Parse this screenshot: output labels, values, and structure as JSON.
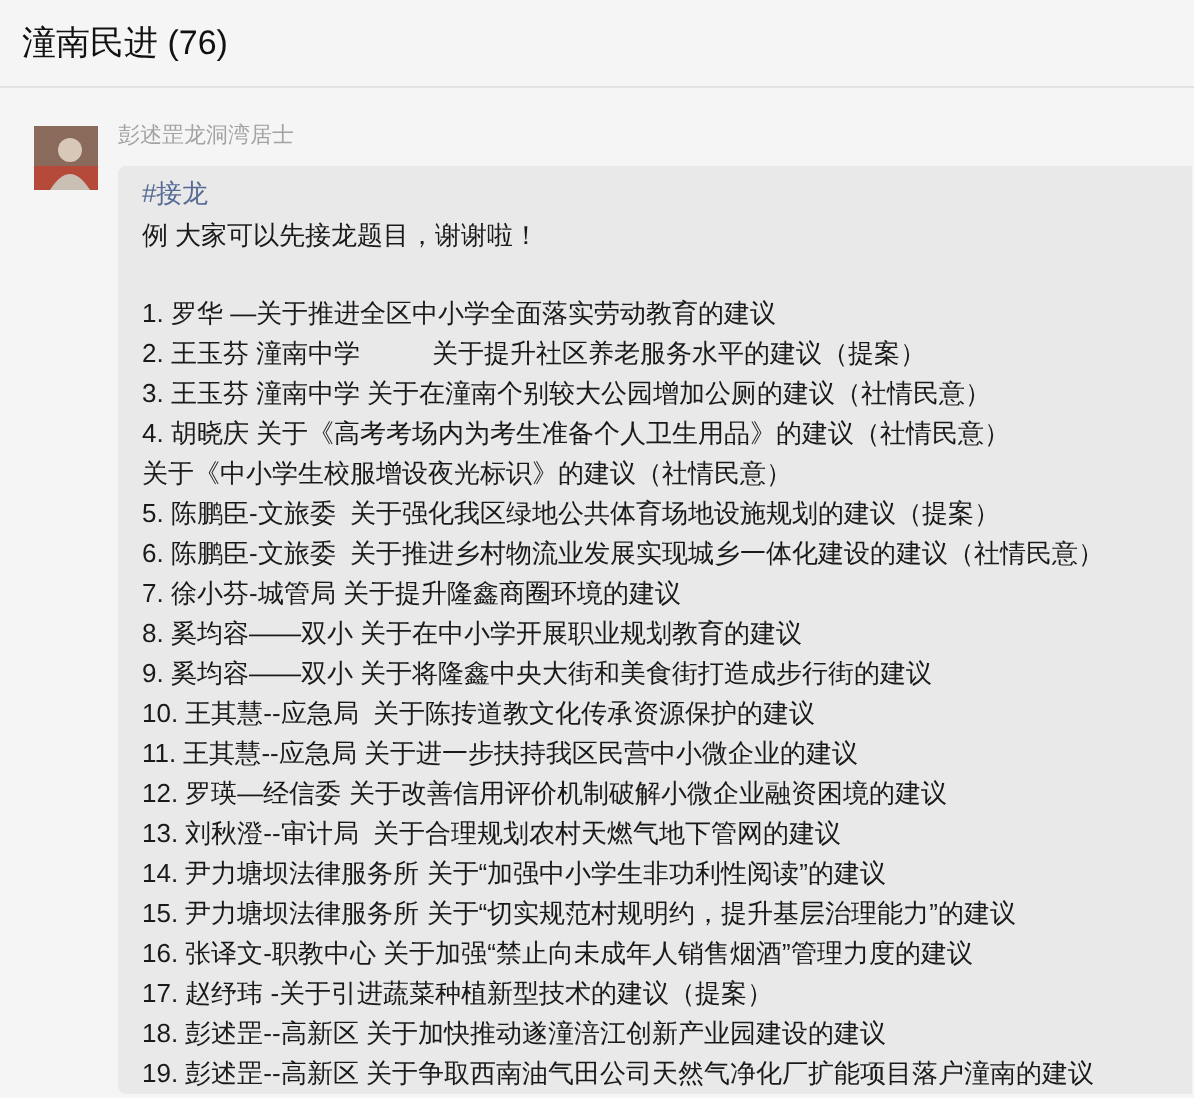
{
  "chat_title": "潼南民进 (76)",
  "message": {
    "sender": "彭述罡龙洞湾居士",
    "tag": "#接龙",
    "intro": "例 大家可以先接龙题目，谢谢啦！",
    "lines": [
      "1. 罗华 —关于推进全区中小学全面落实劳动教育的建议",
      "2. 王玉芬 潼南中学          关于提升社区养老服务水平的建议（提案）",
      "3. 王玉芬 潼南中学 关于在潼南个别较大公园增加公厕的建议（社情民意）",
      "4. 胡晓庆 关于《高考考场内为考生准备个人卫生用品》的建议（社情民意）",
      "关于《中小学生校服增设夜光标识》的建议（社情民意）",
      "5. 陈鹏臣-文旅委  关于强化我区绿地公共体育场地设施规划的建议（提案）",
      "6. 陈鹏臣-文旅委  关于推进乡村物流业发展实现城乡一体化建设的建议（社情民意）",
      "7. 徐小芬-城管局 关于提升隆鑫商圈环境的建议",
      "8. 奚均容——双小 关于在中小学开展职业规划教育的建议",
      "9. 奚均容——双小 关于将隆鑫中央大街和美食街打造成步行街的建议",
      "10. 王其慧--应急局  关于陈抟道教文化传承资源保护的建议",
      "11. 王其慧--应急局 关于进一步扶持我区民营中小微企业的建议",
      "12. 罗瑛—经信委 关于改善信用评价机制破解小微企业融资困境的建议",
      "13. 刘秋澄--审计局  关于合理规划农村天燃气地下管网的建议",
      "14. 尹力塘坝法律服务所 关于“加强中小学生非功利性阅读”的建议",
      "15. 尹力塘坝法律服务所 关于“切实规范村规明约，提升基层治理能力”的建议",
      "16. 张译文-职教中心 关于加强“禁止向未成年人销售烟酒”管理力度的建议",
      "17. 赵纾玮 -关于引进蔬菜种植新型技术的建议（提案）",
      "18. 彭述罡--高新区 关于加快推动遂潼涪江创新产业园建设的建议",
      "19. 彭述罡--高新区 关于争取西南油气田公司天然气净化厂扩能项目落户潼南的建议"
    ]
  }
}
